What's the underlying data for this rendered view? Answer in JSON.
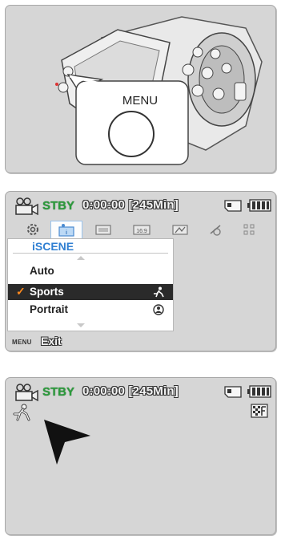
{
  "panel1": {
    "button_label": "MENU"
  },
  "panel2": {
    "status": {
      "mode": "STBY",
      "timecode": "0:00:00 [245Min]",
      "camera_icon": "camera-icon",
      "storage_icon": "memory-card-icon",
      "battery_icon": "battery-full-icon"
    },
    "tabs": [
      {
        "icon": "settings-icon",
        "active": false
      },
      {
        "icon": "iscene-icon",
        "active": true
      },
      {
        "icon": "resolution-icon",
        "active": false
      },
      {
        "icon": "aspect-16-9-icon",
        "active": false
      },
      {
        "icon": "white-balance-icon",
        "active": false
      },
      {
        "icon": "exposure-icon",
        "active": false
      },
      {
        "icon": "grid-icon",
        "active": false
      }
    ],
    "menu": {
      "title": "iSCENE",
      "items": [
        {
          "label": "Auto",
          "icon": "",
          "selected": false
        },
        {
          "label": "Sports",
          "icon": "sports-icon",
          "selected": true
        },
        {
          "label": "Portrait",
          "icon": "portrait-icon",
          "selected": false
        }
      ]
    },
    "footer": {
      "menu_key": "MENU",
      "exit_label": "Exit"
    }
  },
  "panel3": {
    "status": {
      "mode": "STBY",
      "timecode": "0:00:00 [245Min]",
      "camera_icon": "camera-icon",
      "storage_icon": "memory-card-icon",
      "battery_icon": "battery-full-icon"
    },
    "scene_icon": "sports-icon",
    "quality_icon": "super-fine-quality-icon"
  },
  "colors": {
    "panel_bg": "#d6d6d6",
    "stby_green": "#2c9b3c",
    "menu_title_blue": "#2f7fd2",
    "selected_bg": "#2a2a2a",
    "check_orange": "#ff8a1e"
  }
}
